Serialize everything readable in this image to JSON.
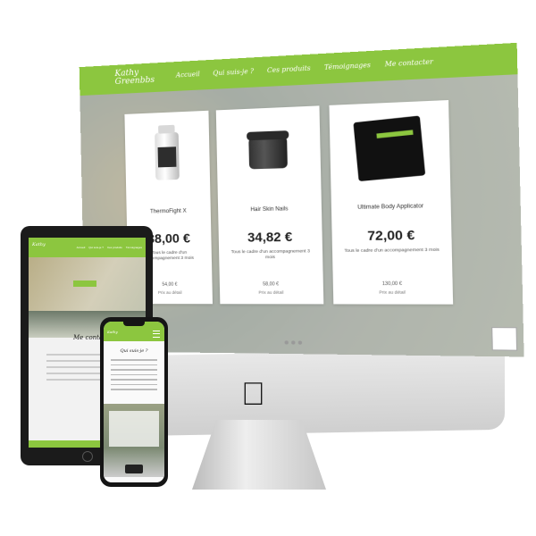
{
  "site": {
    "logo_line1": "Kathy",
    "logo_line2": "Greenbbs",
    "nav": [
      "Accueil",
      "Qui suis-je ?",
      "Ces produits",
      "Témoignages",
      "Me contacter"
    ],
    "products": [
      {
        "name": "ThermoFight X",
        "price": "38,00 €",
        "desc": "Tous le cadre d'un accompagnement 3 mois",
        "ref": "54,00 €",
        "sub": "Prix au détail"
      },
      {
        "name": "Hair Skin Nails",
        "price": "34,82 €",
        "desc": "Tous le cadre d'un accompagnement 3 mois",
        "ref": "58,00 €",
        "sub": "Prix au détail"
      },
      {
        "name": "Ultimate Body Applicator",
        "price": "72,00 €",
        "desc": "Tous le cadre d'un accompagnement 3 mois",
        "ref": "130,00 €",
        "sub": "Prix au détail"
      }
    ]
  },
  "tablet": {
    "title": "Me contacter"
  },
  "phone": {
    "title": "Qui suis-je ?"
  },
  "colors": {
    "brand_green": "#8cc63f"
  },
  "icons": {
    "apple_logo": "apple-logo-icon"
  }
}
